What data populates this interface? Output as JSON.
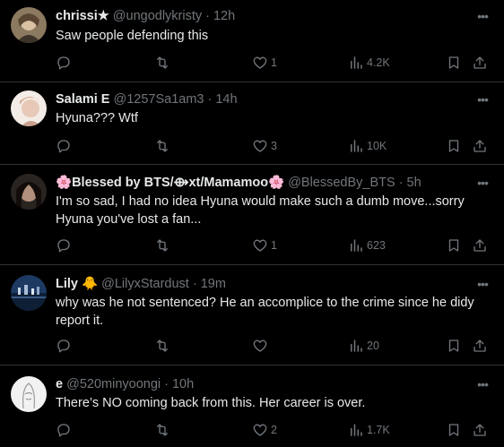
{
  "tweets": [
    {
      "name": "chrissi★",
      "handle": "@ungodlykristy",
      "time": "12h",
      "text": "Saw people defending this",
      "replies": "",
      "retweets": "",
      "likes": "1",
      "views": "4.2K"
    },
    {
      "name": "Salami E",
      "handle": "@1257Sa1am3",
      "time": "14h",
      "text": "Hyuna??? Wtf",
      "replies": "",
      "retweets": "",
      "likes": "3",
      "views": "10K"
    },
    {
      "name_prefix": "🌸",
      "name": "Blessed by BTS/⟴xt/Mamamoo",
      "name_suffix": "🌸",
      "handle": "@BlessedBy_BTS",
      "time": "5h",
      "text": "I'm so sad, I had no idea Hyuna would make such a dumb move...sorry Hyuna you've lost a fan...",
      "replies": "",
      "retweets": "",
      "likes": "1",
      "views": "623"
    },
    {
      "name": "Lily",
      "name_suffix": "🐥",
      "handle": "@LilyxStardust",
      "time": "19m",
      "text": "why was he not sentenced? He an accomplice to the crime since he didy report it.",
      "replies": "",
      "retweets": "",
      "likes": "",
      "views": "20"
    },
    {
      "name": "e",
      "handle": "@520minyoongi",
      "time": "10h",
      "text": "There’s NO coming back from this. Her career is over.",
      "replies": "",
      "retweets": "",
      "likes": "2",
      "views": "1.7K"
    }
  ],
  "icons": {
    "reply": "reply-icon",
    "retweet": "retweet-icon",
    "like": "heart-icon",
    "views": "views-icon",
    "bookmark": "bookmark-icon",
    "share": "share-icon",
    "more": "more-icon"
  },
  "colors": {
    "background": "#000000",
    "text": "#e7e9ea",
    "muted": "#71767b",
    "divider": "#2f3336"
  }
}
